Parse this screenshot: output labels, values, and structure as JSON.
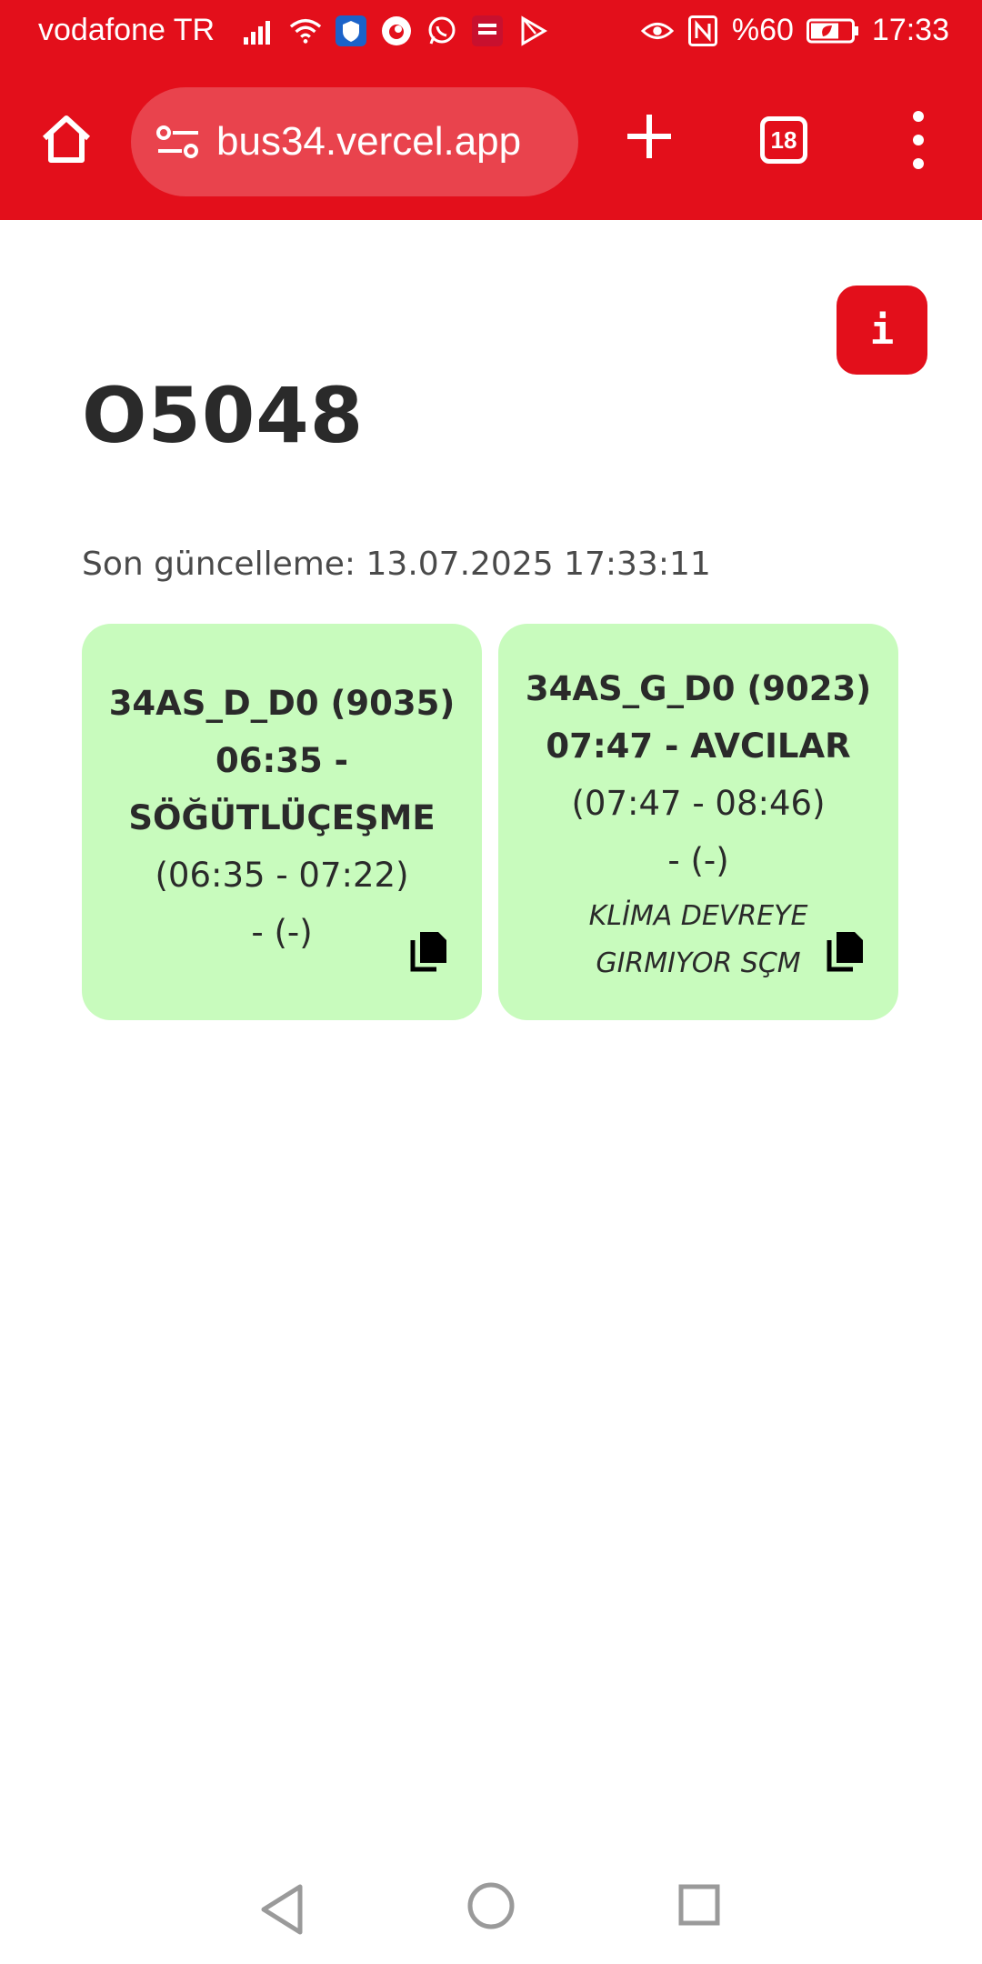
{
  "status_bar": {
    "carrier": "vodafone TR",
    "battery_percent": "%60",
    "time": "17:33"
  },
  "browser": {
    "url": "bus34.vercel.app",
    "tab_count": "18"
  },
  "page": {
    "info_label": "i",
    "title": "O5048",
    "last_update": "Son güncelleme: 13.07.2025 17:33:11"
  },
  "cards": [
    {
      "route_line1": "34AS_D_D0 (9035)",
      "route_line2": "06:35 -",
      "route_line3": "SÖĞÜTLÜÇEŞME",
      "times": "(06:35 - 07:22)",
      "extra": "- (-)",
      "note": ""
    },
    {
      "route_line1": "34AS_G_D0 (9023)",
      "route_line2": "07:47 - AVCILAR",
      "route_line3": "",
      "times": "(07:47 - 08:46)",
      "extra": "- (-)",
      "note": "KLİMA DEVREYE GIRMIYOR SÇM"
    }
  ],
  "colors": {
    "brand_red": "#e30f1b",
    "card_green": "#c8fbbd",
    "text_dark": "#2a2a2a"
  }
}
